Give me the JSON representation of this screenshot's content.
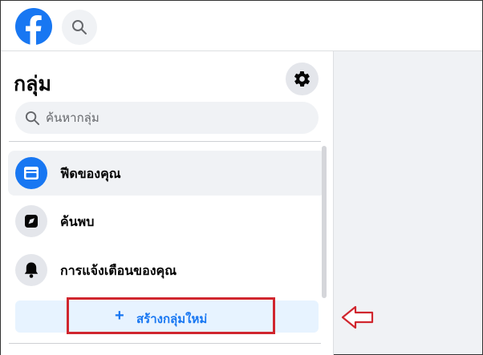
{
  "header": {
    "logo_icon": "facebook-logo-icon",
    "search_icon": "search-icon"
  },
  "sidebar": {
    "title": "กลุ่ม",
    "settings_icon": "gear-icon",
    "search": {
      "placeholder": "ค้นหากลุ่ม"
    },
    "items": [
      {
        "label": "ฟีดของคุณ",
        "icon": "feed-icon",
        "active": true
      },
      {
        "label": "ค้นพบ",
        "icon": "compass-icon",
        "active": false
      },
      {
        "label": "การแจ้งเตือนของคุณ",
        "icon": "bell-icon",
        "active": false
      }
    ],
    "create_button": {
      "plus": "+",
      "label": "สร้างกลุ่มใหม่"
    }
  },
  "annotation": {
    "highlight_color": "#d0262e",
    "arrow_icon": "left-arrow-icon"
  },
  "colors": {
    "brand": "#1877f2",
    "highlight": "#d0262e"
  }
}
